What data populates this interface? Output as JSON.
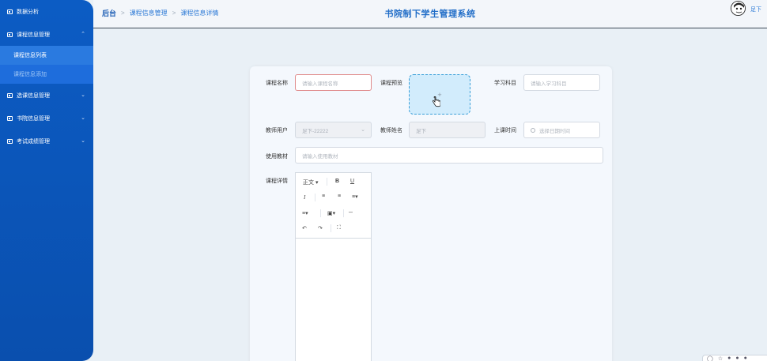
{
  "sidebar": {
    "items": [
      {
        "label": "数据分析",
        "has_chevron": false
      },
      {
        "label": "课程信息管理",
        "has_chevron": true,
        "chevron": "^"
      },
      {
        "label": "选课信息管理",
        "has_chevron": true,
        "chevron": "v"
      },
      {
        "label": "书院信息管理",
        "has_chevron": true,
        "chevron": "v"
      },
      {
        "label": "考试成绩管理",
        "has_chevron": true,
        "chevron": "v"
      }
    ],
    "sub_items": [
      "课程信息列表",
      "课程信息添加"
    ]
  },
  "header": {
    "breadcrumb": [
      "后台",
      "课程信息管理",
      "课程信息详情"
    ],
    "title": "书院制下学生管理系统",
    "user": "足下"
  },
  "form": {
    "course_name_label": "课程名称",
    "course_name_placeholder": "请输入课程名称",
    "preview_label": "课程预览",
    "upload_plus": "+",
    "subject_label": "学习科目",
    "subject_placeholder": "请输入学习科目",
    "teacher_user_label": "教师用户",
    "teacher_user_value": "足下-22222",
    "teacher_name_label": "教师姓名",
    "teacher_name_value": "足下",
    "class_time_label": "上课时间",
    "class_time_placeholder": "选择日期时间",
    "textbook_label": "使用教材",
    "textbook_placeholder": "请输入使用教材",
    "detail_label": "课程详情"
  },
  "editor_toolbar": {
    "paragraph": "正文",
    "bold": "B",
    "underline": "U",
    "italic": "I"
  },
  "colors": {
    "sidebar": "#0c5cc4",
    "accent": "#2d7ad6",
    "upload_bg": "#d2ecfc"
  }
}
